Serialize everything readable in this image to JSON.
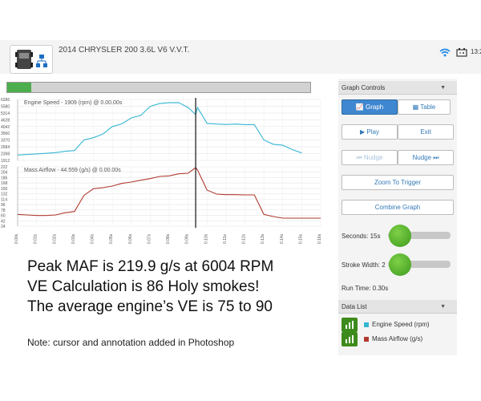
{
  "header": {
    "vehicle_title": "2014 CHRYSLER 200 3.6L V6 V.V.T.",
    "time": "13:2"
  },
  "progress": {
    "value": 0.08
  },
  "graph": {
    "engine_label": "Engine Speed - 1909 (rpm) @ 0.00.00s",
    "maf_label": "Mass Airflow - 44.559 (g/s) @ 0.00.00s",
    "engine_ticks": [
      "6286",
      "5580",
      "5314",
      "4628",
      "4042",
      "3560",
      "3370",
      "2684",
      "2398",
      "1912"
    ],
    "maf_ticks": [
      "222",
      "204",
      "186",
      "168",
      "150",
      "132",
      "114",
      "96",
      "78",
      "60",
      "42",
      "24"
    ],
    "x_ticks": [
      "0.00s",
      "0.01s",
      "0.02s",
      "0.03s",
      "0.04s",
      "0.05s",
      "0.06s",
      "0.07s",
      "0.08s",
      "0.09s",
      "0.10s",
      "0.11s",
      "0.12s",
      "0.13s",
      "0.14s",
      "0.15s",
      "0.16s"
    ]
  },
  "chart_data": [
    {
      "type": "line",
      "ylabel": "Engine Speed (rpm)",
      "color": "#35b6d3",
      "ylim": [
        1912,
        6286
      ],
      "x": [
        0.0,
        0.005,
        0.01,
        0.015,
        0.02,
        0.025,
        0.03,
        0.035,
        0.04,
        0.045,
        0.05,
        0.055,
        0.06,
        0.065,
        0.07,
        0.075,
        0.08,
        0.085,
        0.09,
        0.094,
        0.095,
        0.1,
        0.105,
        0.11,
        0.115,
        0.12,
        0.125,
        0.13,
        0.135,
        0.14,
        0.145,
        0.15
      ],
      "values": [
        2300,
        2340,
        2380,
        2420,
        2470,
        2560,
        2620,
        3380,
        3540,
        3800,
        4340,
        4530,
        4960,
        5140,
        5790,
        5990,
        6050,
        6060,
        5710,
        5200,
        5700,
        4570,
        4520,
        4490,
        4520,
        4480,
        4480,
        3380,
        3070,
        3000,
        2690,
        2450
      ]
    },
    {
      "type": "line",
      "ylabel": "Mass Airflow (g/s)",
      "color": "#b03a2e",
      "ylim": [
        0,
        222
      ],
      "x": [
        0.0,
        0.005,
        0.01,
        0.015,
        0.02,
        0.025,
        0.03,
        0.035,
        0.04,
        0.045,
        0.05,
        0.055,
        0.06,
        0.065,
        0.07,
        0.075,
        0.08,
        0.085,
        0.09,
        0.094,
        0.095,
        0.1,
        0.105,
        0.11,
        0.115,
        0.12,
        0.125,
        0.13,
        0.135,
        0.14,
        0.145,
        0.15,
        0.16
      ],
      "values": [
        44,
        42,
        40,
        40,
        42,
        50,
        55,
        115,
        140,
        144,
        150,
        160,
        165,
        172,
        178,
        186,
        188,
        196,
        198,
        219,
        210,
        135,
        120,
        118,
        118,
        117,
        117,
        44,
        36,
        30,
        30,
        30,
        30
      ]
    }
  ],
  "annotation": {
    "line1": "Peak MAF is 219.9 g/s at 6004 RPM",
    "line2": "VE Calculation is 86   Holy smokes!",
    "line3": "The average engine’s VE is 75 to 90"
  },
  "note": "Note: cursor and annotation added in Photoshop",
  "controls": {
    "header": "Graph Controls",
    "graph_btn": "Graph",
    "table_btn": "Table",
    "play_btn": "Play",
    "exit_btn": "Exit",
    "nudge_back_btn": "Nudge",
    "nudge_fwd_btn": "Nudge",
    "zoom_btn": "Zoom To Trigger",
    "combine_btn": "Combine Graph",
    "seconds_label": "Seconds: 15s",
    "stroke_label": "Stroke Width: 2",
    "runtime_label": "Run Time: 0.30s"
  },
  "data_list": {
    "header": "Data List",
    "items": [
      {
        "label": "Engine Speed (rpm)",
        "color": "#35b6d3"
      },
      {
        "label": "Mass Airflow (g/s)",
        "color": "#b03a2e"
      }
    ]
  }
}
